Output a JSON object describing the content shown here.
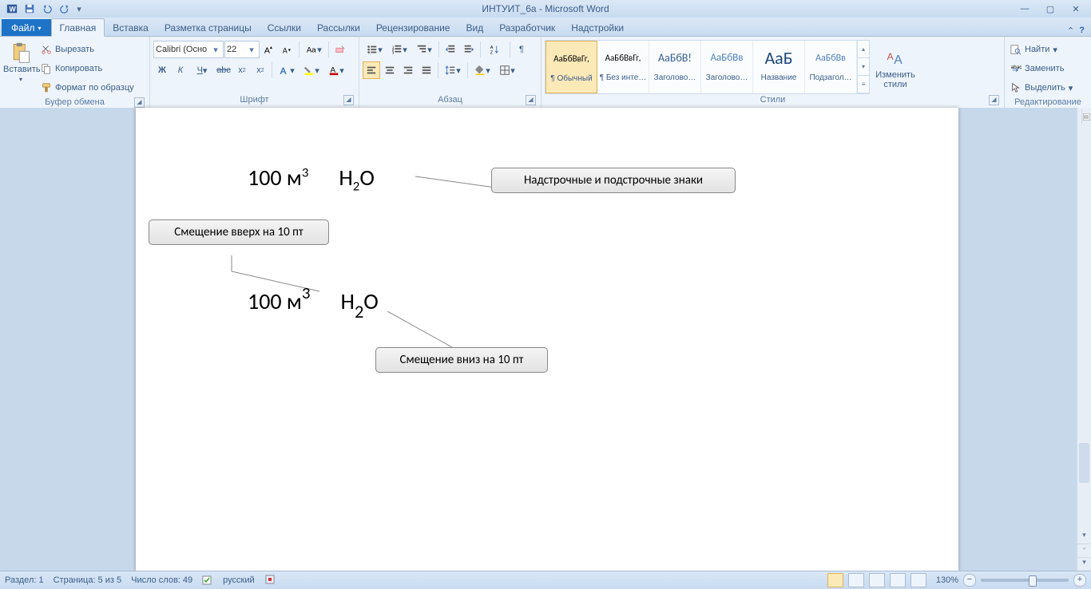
{
  "title": "ИНТУИТ_6а  -  Microsoft Word",
  "tabs": {
    "file": "Файл",
    "home": "Главная",
    "insert": "Вставка",
    "page_layout": "Разметка страницы",
    "references": "Ссылки",
    "mailings": "Рассылки",
    "review": "Рецензирование",
    "view": "Вид",
    "developer": "Разработчик",
    "addins": "Надстройки"
  },
  "clipboard": {
    "paste": "Вставить",
    "cut": "Вырезать",
    "copy": "Копировать",
    "format_painter": "Формат по образцу",
    "group_label": "Буфер обмена"
  },
  "font": {
    "name": "Calibri (Осно",
    "size": "22",
    "group_label": "Шрифт"
  },
  "paragraph": {
    "group_label": "Абзац"
  },
  "styles": {
    "group_label": "Стили",
    "change_styles": "Изменить\nстили",
    "items": [
      {
        "preview": "АаБбВвГг,",
        "name": "¶ Обычный",
        "size": "11px",
        "color": "#000"
      },
      {
        "preview": "АаБбВвГг,",
        "name": "¶ Без инте…",
        "size": "11px",
        "color": "#000"
      },
      {
        "preview": "АаБбВ!",
        "name": "Заголово…",
        "size": "14px",
        "color": "#365f91"
      },
      {
        "preview": "АаБбВв",
        "name": "Заголово…",
        "size": "13px",
        "color": "#4f81bd"
      },
      {
        "preview": "АаБ",
        "name": "Название",
        "size": "22px",
        "color": "#1f497d"
      },
      {
        "preview": "АаБбВв",
        "name": "Подзагол…",
        "size": "12px",
        "color": "#4f81bd"
      }
    ]
  },
  "editing": {
    "group_label": "Редактирование",
    "find": "Найти",
    "replace": "Заменить",
    "select": "Выделить"
  },
  "document": {
    "line1_text": "100 м",
    "line1_sup": "3",
    "line1_formula_h": "H",
    "line1_formula_sub": "2",
    "line1_formula_o": "O",
    "line2_text": "100 м",
    "line2_raised": "3",
    "line2_formula_h": "H",
    "line2_formula_low": "2",
    "line2_formula_o": "O",
    "callout1": "Надстрочные и подстрочные знаки",
    "callout2": "Смещение вверх на 10 пт",
    "callout3": "Смещение вниз на 10 пт"
  },
  "status": {
    "section": "Раздел: 1",
    "page": "Страница: 5 из 5",
    "words": "Число слов: 49",
    "language": "русский",
    "zoom": "130%"
  }
}
